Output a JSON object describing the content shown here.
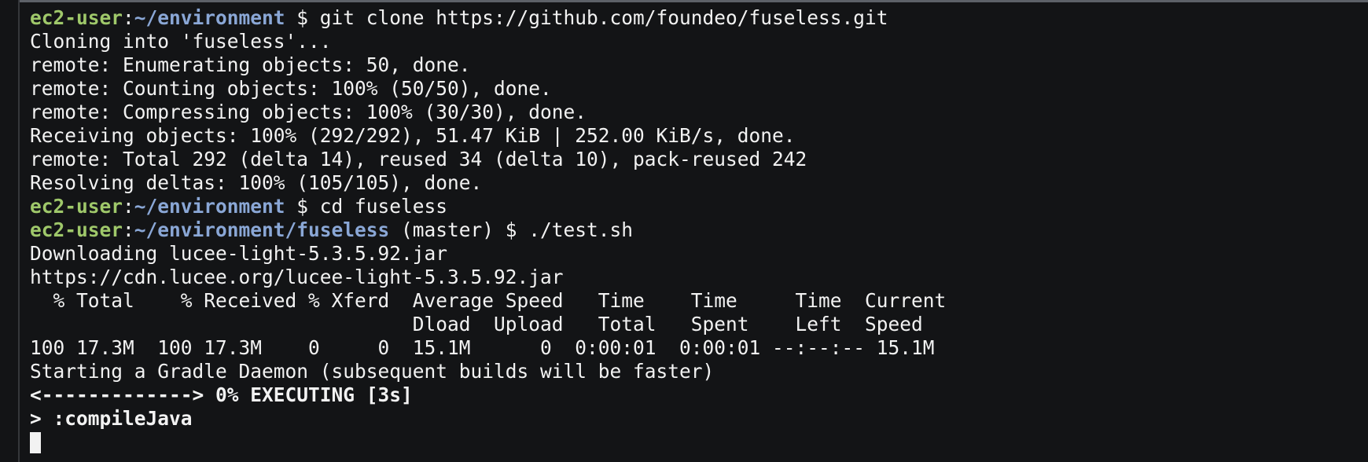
{
  "prompt_user": "ec2-user",
  "prompt_sep": ":",
  "lines": [
    {
      "kind": "prompt",
      "path": "~/environment",
      "suffix": " $ git clone https://github.com/foundeo/fuseless.git"
    },
    {
      "kind": "out",
      "text": "Cloning into 'fuseless'..."
    },
    {
      "kind": "out",
      "text": "remote: Enumerating objects: 50, done."
    },
    {
      "kind": "out",
      "text": "remote: Counting objects: 100% (50/50), done."
    },
    {
      "kind": "out",
      "text": "remote: Compressing objects: 100% (30/30), done."
    },
    {
      "kind": "out",
      "text": "Receiving objects: 100% (292/292), 51.47 KiB | 252.00 KiB/s, done."
    },
    {
      "kind": "out",
      "text": "remote: Total 292 (delta 14), reused 34 (delta 10), pack-reused 242"
    },
    {
      "kind": "out",
      "text": "Resolving deltas: 100% (105/105), done."
    },
    {
      "kind": "prompt",
      "path": "~/environment",
      "suffix": " $ cd fuseless"
    },
    {
      "kind": "prompt",
      "path": "~/environment/fuseless",
      "suffix": " (master) $ ./test.sh"
    },
    {
      "kind": "out",
      "text": "Downloading lucee-light-5.3.5.92.jar"
    },
    {
      "kind": "out",
      "text": "https://cdn.lucee.org/lucee-light-5.3.5.92.jar"
    },
    {
      "kind": "out",
      "text": "  % Total    % Received % Xferd  Average Speed   Time    Time     Time  Current"
    },
    {
      "kind": "out",
      "text": "                                 Dload  Upload   Total   Spent    Left  Speed"
    },
    {
      "kind": "out",
      "text": "100 17.3M  100 17.3M    0     0  15.1M      0  0:00:01  0:00:01 --:--:-- 15.1M"
    },
    {
      "kind": "out",
      "text": "Starting a Gradle Daemon (subsequent builds will be faster)"
    },
    {
      "kind": "bold",
      "text": "<-------------> 0% EXECUTING [3s]"
    },
    {
      "kind": "bold",
      "text": "> :compileJava"
    }
  ]
}
